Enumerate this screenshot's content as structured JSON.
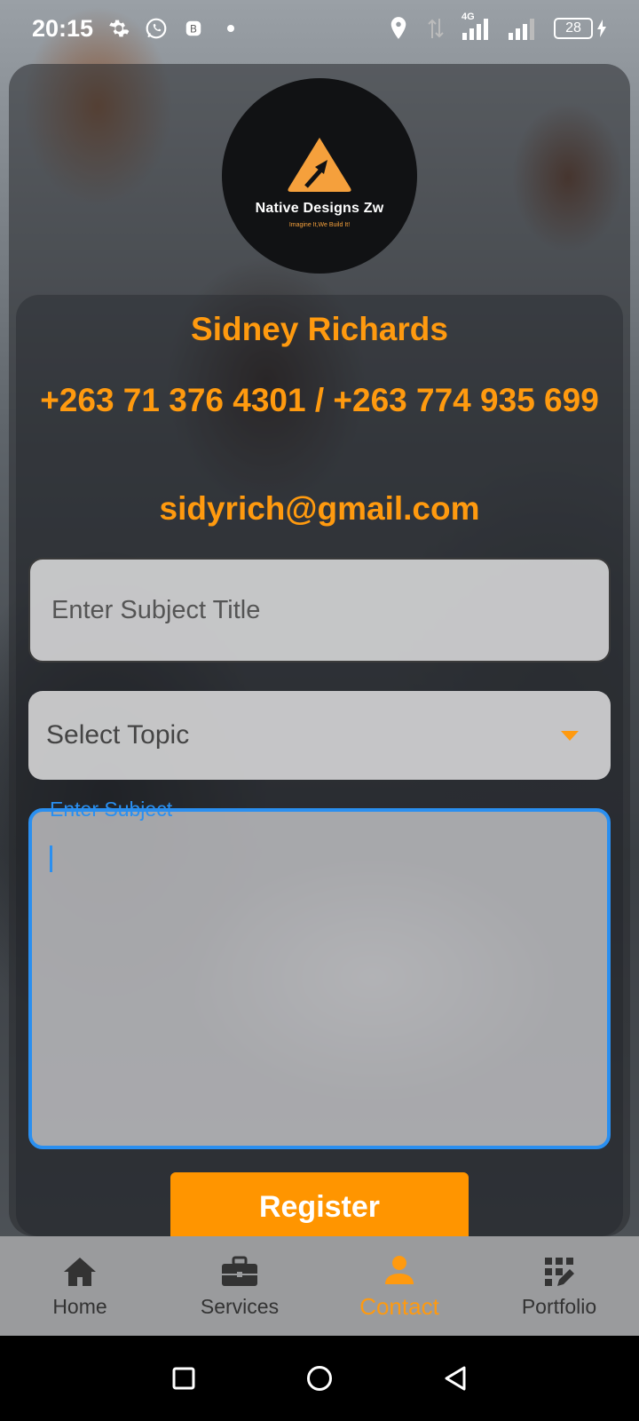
{
  "status_bar": {
    "time": "20:15",
    "network": "4G",
    "battery": "28"
  },
  "logo": {
    "name": "Native Designs Zw",
    "tagline": "Imagine It,We Build It!"
  },
  "contact": {
    "name": "Sidney Richards",
    "phone": "+263 71 376 4301 / +263 774 935 699",
    "email": "sidyrich@gmail.com"
  },
  "form": {
    "subject_title_placeholder": "Enter Subject Title",
    "topic_placeholder": "Select Topic",
    "subject_label": "Enter Subject",
    "register_label": "Register"
  },
  "bottom_nav": {
    "items": [
      {
        "label": "Home",
        "icon": "home-icon"
      },
      {
        "label": "Services",
        "icon": "briefcase-icon"
      },
      {
        "label": "Contact",
        "icon": "person-icon",
        "active": true
      },
      {
        "label": "Portfolio",
        "icon": "portfolio-icon"
      }
    ]
  },
  "colors": {
    "accent": "#ff9a0f",
    "focus": "#2a8ff0",
    "button": "#ff9500"
  }
}
